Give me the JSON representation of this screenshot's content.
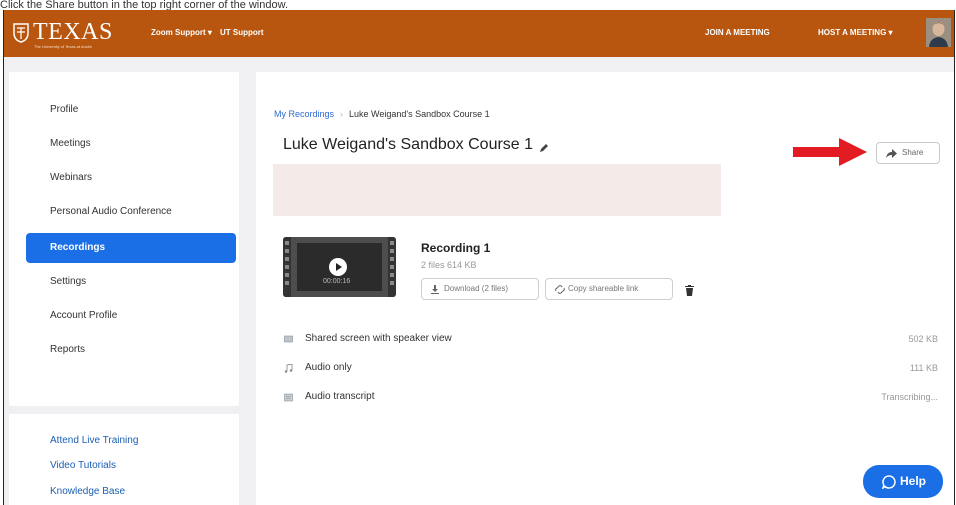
{
  "caption": "Click the Share button in the top right corner of the window.",
  "colors": {
    "brand": "#b8560f",
    "accent": "#1a6fe6",
    "arrow": "#e31b23"
  },
  "header": {
    "logo_text": "TEXAS",
    "logo_subtext": "The University of Texas at Austin",
    "nav_left": [
      "Zoom Support ▾",
      "UT Support"
    ],
    "join_meeting": "JOIN A MEETING",
    "host_meeting": "HOST A MEETING ▾"
  },
  "sidebar": {
    "items": [
      {
        "label": "Profile"
      },
      {
        "label": "Meetings"
      },
      {
        "label": "Webinars"
      },
      {
        "label": "Personal Audio Conference"
      },
      {
        "label": "Recordings",
        "active": true
      },
      {
        "label": "Settings"
      },
      {
        "label": "Account Profile"
      },
      {
        "label": "Reports"
      }
    ],
    "links": [
      "Attend Live Training",
      "Video Tutorials",
      "Knowledge Base"
    ]
  },
  "main": {
    "breadcrumb": {
      "parent": "My Recordings",
      "separator": "›",
      "current": "Luke Weigand's Sandbox Course 1"
    },
    "title": "Luke Weigand's Sandbox Course 1",
    "share_label": "Share",
    "recording": {
      "title": "Recording 1",
      "meta": "2 files  614 KB",
      "duration": "00:00:16",
      "download_label": "Download (2 files)",
      "copy_link_label": "Copy shareable link"
    },
    "files": [
      {
        "icon": "screen-icon",
        "name": "Shared screen with speaker view",
        "size": "502 KB"
      },
      {
        "icon": "music-note-icon",
        "name": "Audio only",
        "size": "111 KB"
      },
      {
        "icon": "transcript-icon",
        "name": "Audio transcript",
        "size": "Transcribing..."
      }
    ]
  },
  "help_label": "Help"
}
